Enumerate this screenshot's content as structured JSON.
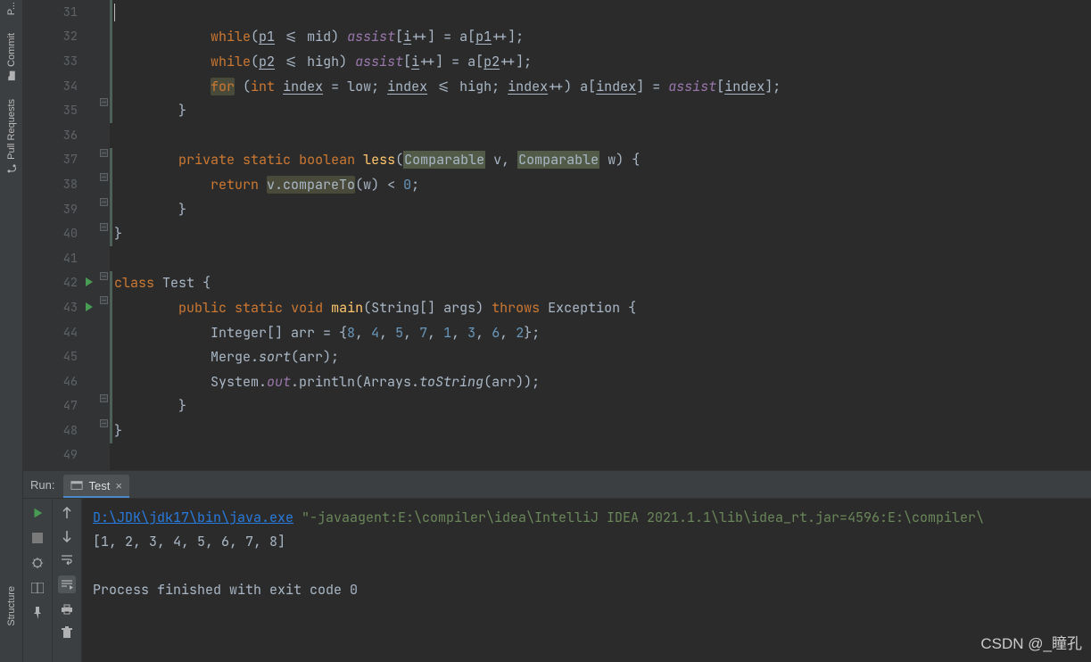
{
  "sidebar": {
    "labels": [
      "P...",
      "Commit",
      "Pull Requests",
      "Structure"
    ]
  },
  "gutter": {
    "start": 31,
    "end": 49,
    "run_markers": [
      42,
      43
    ],
    "at_markers": [
      37
    ]
  },
  "code": {
    "l31": "",
    "l32_a": "            ",
    "l32_kw": "while",
    "l32_b": "(",
    "l32_u1": "p1",
    "l32_c": " <= mid) ",
    "l32_it": "assist",
    "l32_d": "[",
    "l32_u2": "i",
    "l32_e": "++] = a[",
    "l32_u3": "p1",
    "l32_f": "++];",
    "l33_a": "            ",
    "l33_kw": "while",
    "l33_b": "(",
    "l33_u1": "p2",
    "l33_c": " <= high) ",
    "l33_it": "assist",
    "l33_d": "[",
    "l33_u2": "i",
    "l33_e": "++] = a[",
    "l33_u3": "p2",
    "l33_f": "++];",
    "l34_a": "            ",
    "l34_for": "for",
    "l34_b": " (",
    "l34_int": "int",
    "l34_c": " ",
    "l34_u1": "index",
    "l34_d": " = low; ",
    "l34_u2": "index",
    "l34_e": " <= high; ",
    "l34_u3": "index",
    "l34_f": "++) a[",
    "l34_u4": "index",
    "l34_g": "] = ",
    "l34_it": "assist",
    "l34_h": "[",
    "l34_u5": "index",
    "l34_i": "];",
    "l35": "        }",
    "l36": "",
    "l37_a": "        ",
    "l37_kw1": "private",
    "l37_s1": " ",
    "l37_kw2": "static",
    "l37_s2": " ",
    "l37_kw3": "boolean",
    "l37_s3": " ",
    "l37_fn": "less",
    "l37_b": "(",
    "l37_c1": "Comparable",
    "l37_c": " v, ",
    "l37_c2": "Comparable",
    "l37_d": " w) {",
    "l38_a": "            ",
    "l38_kw": "return",
    "l38_b": " ",
    "l38_hl": "v.compareTo",
    "l38_c": "(w) < ",
    "l38_n": "0",
    "l38_d": ";",
    "l39": "        }",
    "l40": "}",
    "l41": "",
    "l42_a": "",
    "l42_kw": "class",
    "l42_b": " Test {",
    "l43_a": "        ",
    "l43_kw1": "public",
    "l43_s1": " ",
    "l43_kw2": "static",
    "l43_s2": " ",
    "l43_kw3": "void",
    "l43_s3": " ",
    "l43_fn": "main",
    "l43_b": "(String[] args) ",
    "l43_kw4": "throws",
    "l43_c": " Exception {",
    "l44_a": "            Integer[] arr = {",
    "l44_n1": "8",
    "l44_c1": ", ",
    "l44_n2": "4",
    "l44_c2": ", ",
    "l44_n3": "5",
    "l44_c3": ", ",
    "l44_n4": "7",
    "l44_c4": ", ",
    "l44_n5": "1",
    "l44_c5": ", ",
    "l44_n6": "3",
    "l44_c6": ", ",
    "l44_n7": "6",
    "l44_c7": ", ",
    "l44_n8": "2",
    "l44_b": "};",
    "l45_a": "            Merge.",
    "l45_it": "sort",
    "l45_b": "(arr);",
    "l46_a": "            System.",
    "l46_it": "out",
    "l46_b": ".println(Arrays.",
    "l46_it2": "toString",
    "l46_c": "(arr));",
    "l47": "        }",
    "l48": "}",
    "l49": ""
  },
  "run": {
    "label": "Run:",
    "tab": "Test",
    "java_path": "D:\\JDK\\jdk17\\bin\\java.exe",
    "java_args": " \"-javaagent:E:\\compiler\\idea\\IntelliJ IDEA 2021.1.1\\lib\\idea_rt.jar=4596:E:\\compiler\\",
    "output": "[1, 2, 3, 4, 5, 6, 7, 8]",
    "exit": "Process finished with exit code 0"
  },
  "watermark": "CSDN @_瞳孔"
}
